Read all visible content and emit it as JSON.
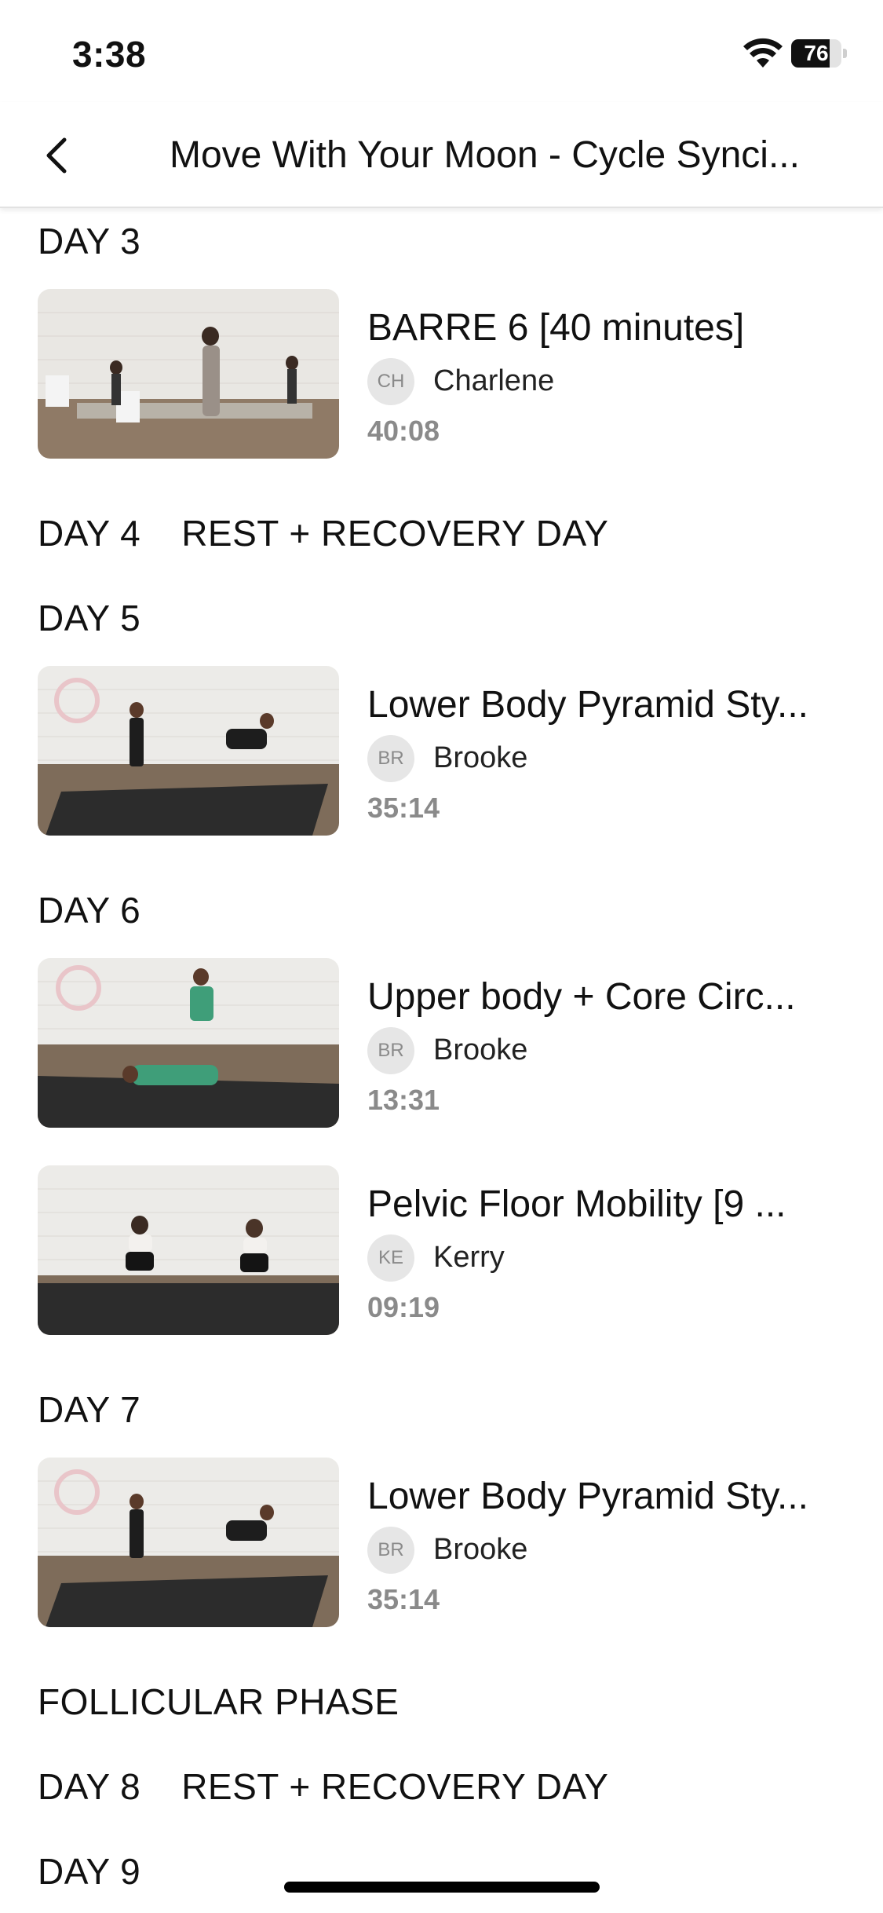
{
  "status_bar": {
    "time": "3:38",
    "battery_level": "76",
    "battery_fraction": 0.76
  },
  "nav": {
    "title": "Move With Your Moon - Cycle Synci..."
  },
  "items": [
    {
      "type": "day",
      "label": "DAY 3"
    },
    {
      "type": "video",
      "title": "BARRE 6 [40 minutes]",
      "initials": "CH",
      "instructor": "Charlene",
      "duration": "40:08"
    },
    {
      "type": "day",
      "label": "DAY 4",
      "note": "REST + RECOVERY DAY"
    },
    {
      "type": "day",
      "label": "DAY 5"
    },
    {
      "type": "video",
      "title": "Lower Body Pyramid Sty...",
      "initials": "BR",
      "instructor": "Brooke",
      "duration": "35:14"
    },
    {
      "type": "day",
      "label": "DAY 6"
    },
    {
      "type": "video",
      "title": "Upper body + Core Circ...",
      "initials": "BR",
      "instructor": "Brooke",
      "duration": "13:31"
    },
    {
      "type": "video",
      "title": "Pelvic Floor Mobility [9 ...",
      "initials": "KE",
      "instructor": "Kerry",
      "duration": "09:19"
    },
    {
      "type": "day",
      "label": "DAY 7"
    },
    {
      "type": "video",
      "title": "Lower Body Pyramid Sty...",
      "initials": "BR",
      "instructor": "Brooke",
      "duration": "35:14"
    },
    {
      "type": "day",
      "label": "FOLLICULAR PHASE"
    },
    {
      "type": "day",
      "label": "DAY 8",
      "note": "REST + RECOVERY DAY"
    },
    {
      "type": "day",
      "label": "DAY 9"
    }
  ]
}
